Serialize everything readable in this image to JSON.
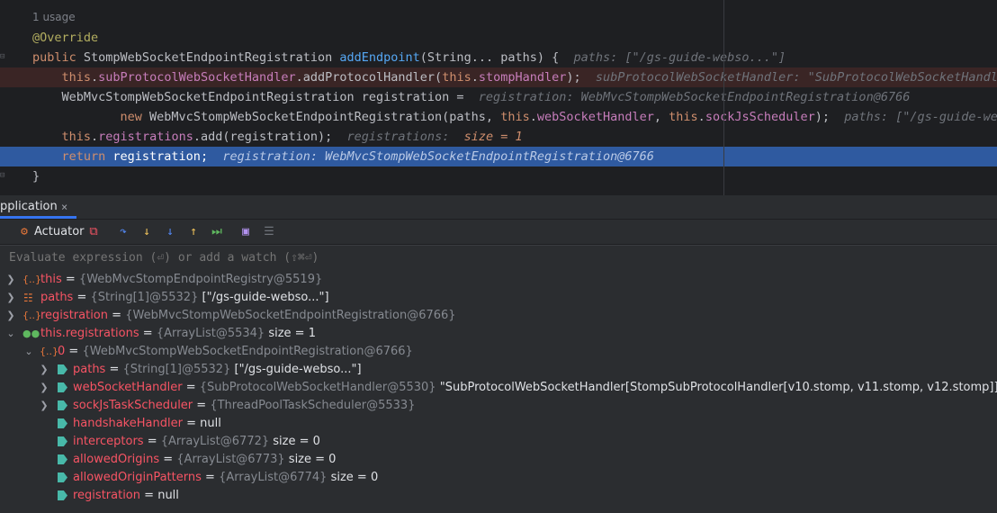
{
  "editor": {
    "usage": "1 usage",
    "lines": [
      [
        {
          "t": "@Override",
          "c": "ann"
        }
      ],
      [
        {
          "t": "public ",
          "c": "kw"
        },
        {
          "t": "StompWebSocketEndpointRegistration ",
          "c": ""
        },
        {
          "t": "addEndpoint",
          "c": "fn"
        },
        {
          "t": "(String... paths) {  ",
          "c": ""
        },
        {
          "t": "paths: [\"/gs-guide-webso...\"]",
          "c": "hint"
        }
      ],
      [
        {
          "t": "    this",
          "c": "kw"
        },
        {
          "t": ".",
          "c": ""
        },
        {
          "t": "subProtocolWebSocketHandler",
          "c": "fld"
        },
        {
          "t": ".addProtocolHandler(",
          "c": ""
        },
        {
          "t": "this",
          "c": "kw"
        },
        {
          "t": ".",
          "c": ""
        },
        {
          "t": "stompHandler",
          "c": "fld"
        },
        {
          "t": ");  ",
          "c": ""
        },
        {
          "t": "subProtocolWebSocketHandler: \"SubProtocolWebSocketHandler[StompSubProtocolHandler",
          "c": "hint"
        }
      ],
      [
        {
          "t": "    WebMvcStompWebSocketEndpointRegistration registration =  ",
          "c": ""
        },
        {
          "t": "registration: WebMvcStompWebSocketEndpointRegistration@6766",
          "c": "hint"
        }
      ],
      [
        {
          "t": "            new ",
          "c": "kw"
        },
        {
          "t": "WebMvcStompWebSocketEndpointRegistration(paths, ",
          "c": ""
        },
        {
          "t": "this",
          "c": "kw"
        },
        {
          "t": ".",
          "c": ""
        },
        {
          "t": "webSocketHandler",
          "c": "fld"
        },
        {
          "t": ", ",
          "c": ""
        },
        {
          "t": "this",
          "c": "kw"
        },
        {
          "t": ".",
          "c": ""
        },
        {
          "t": "sockJsScheduler",
          "c": "fld"
        },
        {
          "t": ");  ",
          "c": ""
        },
        {
          "t": "paths: [\"/gs-guide-websocket\"]",
          "c": "hint"
        }
      ],
      [
        {
          "t": "    this",
          "c": "kw"
        },
        {
          "t": ".",
          "c": ""
        },
        {
          "t": "registrations",
          "c": "fld"
        },
        {
          "t": ".add(registration);  ",
          "c": ""
        },
        {
          "t": "registrations:  ",
          "c": "hint"
        },
        {
          "t": "size = 1",
          "c": "hintnum"
        }
      ],
      [
        {
          "t": "    return ",
          "c": "kw"
        },
        {
          "t": "registration;  ",
          "c": ""
        },
        {
          "t": "registration: WebMvcStompWebSocketEndpointRegistration@6766",
          "c": "hint"
        }
      ],
      [
        {
          "t": "}",
          "c": ""
        }
      ]
    ]
  },
  "debug": {
    "tab_label": "pplication",
    "tab_close": "×",
    "actuator_label": "Actuator",
    "eval_placeholder": "Evaluate expression (⏎) or add a watch (⇧⌘⏎)"
  },
  "vars": [
    {
      "name": "this",
      "type": "{WebMvcStompEndpointRegistry@5519}",
      "value": ""
    },
    {
      "name": "paths",
      "type": "{String[1]@5532}",
      "value": "[\"/gs-guide-webso...\"]"
    },
    {
      "name": "registration",
      "type": "{WebMvcStompWebSocketEndpointRegistration@6766}",
      "value": ""
    },
    {
      "name": "this.registrations",
      "type": "{ArrayList@5534}",
      "value": "size = 1"
    },
    {
      "name": "0",
      "type": "{WebMvcStompWebSocketEndpointRegistration@6766}",
      "value": ""
    },
    {
      "name": "paths",
      "type": "{String[1]@5532}",
      "value": "[\"/gs-guide-webso...\"]"
    },
    {
      "name": "webSocketHandler",
      "type": "{SubProtocolWebSocketHandler@5530}",
      "value": "\"SubProtocolWebSocketHandler[StompSubProtocolHandler[v10.stomp, v11.stomp, v12.stomp]]\""
    },
    {
      "name": "sockJsTaskScheduler",
      "type": "{ThreadPoolTaskScheduler@5533}",
      "value": ""
    },
    {
      "name": "handshakeHandler",
      "type": "",
      "value": "null"
    },
    {
      "name": "interceptors",
      "type": "{ArrayList@6772}",
      "value": "size = 0"
    },
    {
      "name": "allowedOrigins",
      "type": "{ArrayList@6773}",
      "value": "size = 0"
    },
    {
      "name": "allowedOriginPatterns",
      "type": "{ArrayList@6774}",
      "value": "size = 0"
    },
    {
      "name": "registration",
      "type": "",
      "value": "null"
    }
  ],
  "eq": "="
}
